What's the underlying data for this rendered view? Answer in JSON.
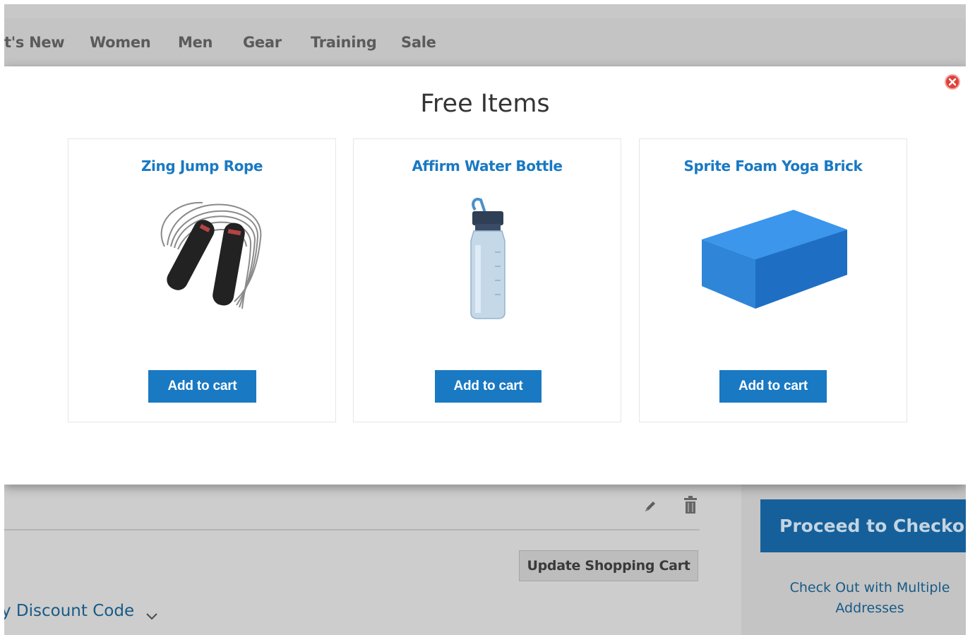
{
  "nav": {
    "items": [
      "t's New",
      "Women",
      "Men",
      "Gear",
      "Training",
      "Sale"
    ]
  },
  "modal": {
    "title": "Free Items",
    "close_icon": "close-icon",
    "products": [
      {
        "name": "Zing Jump Rope",
        "button": "Add to cart",
        "image": "jump-rope-image"
      },
      {
        "name": "Affirm Water Bottle",
        "button": "Add to cart",
        "image": "water-bottle-image"
      },
      {
        "name": "Sprite Foam Yoga Brick",
        "button": "Add to cart",
        "image": "yoga-brick-image"
      }
    ]
  },
  "cart": {
    "update_button": "Update Shopping Cart",
    "discount_label": "y Discount Code",
    "edit_icon": "pencil-icon",
    "delete_icon": "trash-icon"
  },
  "summary": {
    "checkout_button": "Proceed to Checkout",
    "multiple_addresses_link": "Check Out with Multiple Addresses"
  },
  "colors": {
    "accent": "#1979c3",
    "checkout": "#15609a",
    "close": "#e0413a"
  }
}
